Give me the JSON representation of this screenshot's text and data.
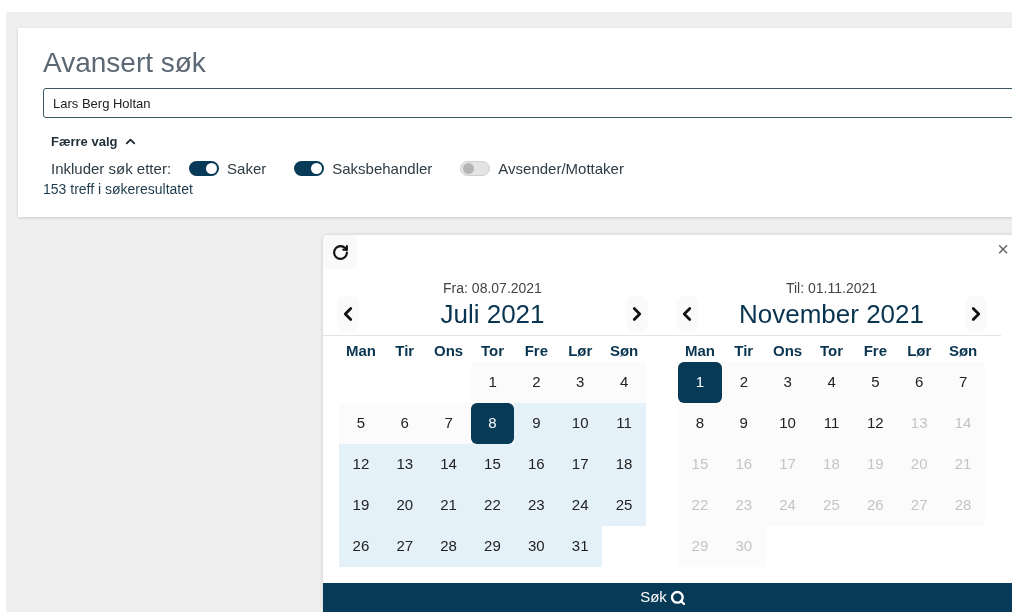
{
  "search": {
    "title": "Avansert søk",
    "query": "Lars Berg Holtan",
    "toggle_label": "Færre valg",
    "include_label": "Inkluder søk etter:",
    "filters": [
      {
        "label": "Saker",
        "on": true
      },
      {
        "label": "Saksbehandler",
        "on": true
      },
      {
        "label": "Avsender/Mottaker",
        "on": false
      }
    ],
    "result_count": "153 treff i søkeresultatet"
  },
  "date_picker": {
    "close": "×",
    "months": [
      {
        "caption": "Fra: 08.07.2021",
        "title": "Juli 2021",
        "weekdays": [
          "Man",
          "Tir",
          "Ons",
          "Tor",
          "Fre",
          "Lør",
          "Søn"
        ],
        "weeks": [
          [
            {
              "day": "1",
              "selected": false,
              "in_range": false,
              "disabled": false
            },
            {
              "day": "2",
              "selected": false,
              "in_range": false,
              "disabled": false
            },
            {
              "day": "3",
              "selected": false,
              "in_range": false,
              "disabled": false
            },
            {
              "day": "4",
              "selected": false,
              "in_range": false,
              "disabled": false
            }
          ],
          [
            {
              "day": "5",
              "selected": false,
              "in_range": false,
              "disabled": false
            },
            {
              "day": "6",
              "selected": false,
              "in_range": false,
              "disabled": false
            },
            {
              "day": "7",
              "selected": false,
              "in_range": false,
              "disabled": false
            },
            {
              "day": "8",
              "selected": true,
              "in_range": false,
              "disabled": false
            },
            {
              "day": "9",
              "selected": false,
              "in_range": true,
              "disabled": false
            },
            {
              "day": "10",
              "selected": false,
              "in_range": true,
              "disabled": false
            },
            {
              "day": "11",
              "selected": false,
              "in_range": true,
              "disabled": false
            }
          ],
          [
            {
              "day": "12",
              "selected": false,
              "in_range": true,
              "disabled": false
            },
            {
              "day": "13",
              "selected": false,
              "in_range": true,
              "disabled": false
            },
            {
              "day": "14",
              "selected": false,
              "in_range": true,
              "disabled": false
            },
            {
              "day": "15",
              "selected": false,
              "in_range": true,
              "disabled": false
            },
            {
              "day": "16",
              "selected": false,
              "in_range": true,
              "disabled": false
            },
            {
              "day": "17",
              "selected": false,
              "in_range": true,
              "disabled": false
            },
            {
              "day": "18",
              "selected": false,
              "in_range": true,
              "disabled": false
            }
          ],
          [
            {
              "day": "19",
              "selected": false,
              "in_range": true,
              "disabled": false
            },
            {
              "day": "20",
              "selected": false,
              "in_range": true,
              "disabled": false
            },
            {
              "day": "21",
              "selected": false,
              "in_range": true,
              "disabled": false
            },
            {
              "day": "22",
              "selected": false,
              "in_range": true,
              "disabled": false
            },
            {
              "day": "23",
              "selected": false,
              "in_range": true,
              "disabled": false
            },
            {
              "day": "24",
              "selected": false,
              "in_range": true,
              "disabled": false
            },
            {
              "day": "25",
              "selected": false,
              "in_range": true,
              "disabled": false
            }
          ],
          [
            {
              "day": "26",
              "selected": false,
              "in_range": true,
              "disabled": false
            },
            {
              "day": "27",
              "selected": false,
              "in_range": true,
              "disabled": false
            },
            {
              "day": "28",
              "selected": false,
              "in_range": true,
              "disabled": false
            },
            {
              "day": "29",
              "selected": false,
              "in_range": true,
              "disabled": false
            },
            {
              "day": "30",
              "selected": false,
              "in_range": true,
              "disabled": false
            },
            {
              "day": "31",
              "selected": false,
              "in_range": true,
              "disabled": false
            }
          ]
        ]
      },
      {
        "caption": "Til: 01.11.2021",
        "title": "November 2021",
        "weekdays": [
          "Man",
          "Tir",
          "Ons",
          "Tor",
          "Fre",
          "Lør",
          "Søn"
        ],
        "weeks": [
          [
            {
              "day": "1",
              "selected": true,
              "in_range": false,
              "disabled": false
            },
            {
              "day": "2",
              "selected": false,
              "in_range": false,
              "disabled": false
            },
            {
              "day": "3",
              "selected": false,
              "in_range": false,
              "disabled": false
            },
            {
              "day": "4",
              "selected": false,
              "in_range": false,
              "disabled": false
            },
            {
              "day": "5",
              "selected": false,
              "in_range": false,
              "disabled": false
            },
            {
              "day": "6",
              "selected": false,
              "in_range": false,
              "disabled": false
            },
            {
              "day": "7",
              "selected": false,
              "in_range": false,
              "disabled": false
            }
          ],
          [
            {
              "day": "8",
              "selected": false,
              "in_range": false,
              "disabled": false
            },
            {
              "day": "9",
              "selected": false,
              "in_range": false,
              "disabled": false
            },
            {
              "day": "10",
              "selected": false,
              "in_range": false,
              "disabled": false
            },
            {
              "day": "11",
              "selected": false,
              "in_range": false,
              "disabled": false
            },
            {
              "day": "12",
              "selected": false,
              "in_range": false,
              "disabled": false
            },
            {
              "day": "13",
              "selected": false,
              "in_range": false,
              "disabled": true
            },
            {
              "day": "14",
              "selected": false,
              "in_range": false,
              "disabled": true
            }
          ],
          [
            {
              "day": "15",
              "selected": false,
              "in_range": false,
              "disabled": true
            },
            {
              "day": "16",
              "selected": false,
              "in_range": false,
              "disabled": true
            },
            {
              "day": "17",
              "selected": false,
              "in_range": false,
              "disabled": true
            },
            {
              "day": "18",
              "selected": false,
              "in_range": false,
              "disabled": true
            },
            {
              "day": "19",
              "selected": false,
              "in_range": false,
              "disabled": true
            },
            {
              "day": "20",
              "selected": false,
              "in_range": false,
              "disabled": true
            },
            {
              "day": "21",
              "selected": false,
              "in_range": false,
              "disabled": true
            }
          ],
          [
            {
              "day": "22",
              "selected": false,
              "in_range": false,
              "disabled": true
            },
            {
              "day": "23",
              "selected": false,
              "in_range": false,
              "disabled": true
            },
            {
              "day": "24",
              "selected": false,
              "in_range": false,
              "disabled": true
            },
            {
              "day": "25",
              "selected": false,
              "in_range": false,
              "disabled": true
            },
            {
              "day": "26",
              "selected": false,
              "in_range": false,
              "disabled": true
            },
            {
              "day": "27",
              "selected": false,
              "in_range": false,
              "disabled": true
            },
            {
              "day": "28",
              "selected": false,
              "in_range": false,
              "disabled": true
            }
          ],
          [
            {
              "day": "29",
              "selected": false,
              "in_range": false,
              "disabled": true
            },
            {
              "day": "30",
              "selected": false,
              "in_range": false,
              "disabled": true
            }
          ]
        ]
      }
    ],
    "submit": "Søk"
  }
}
